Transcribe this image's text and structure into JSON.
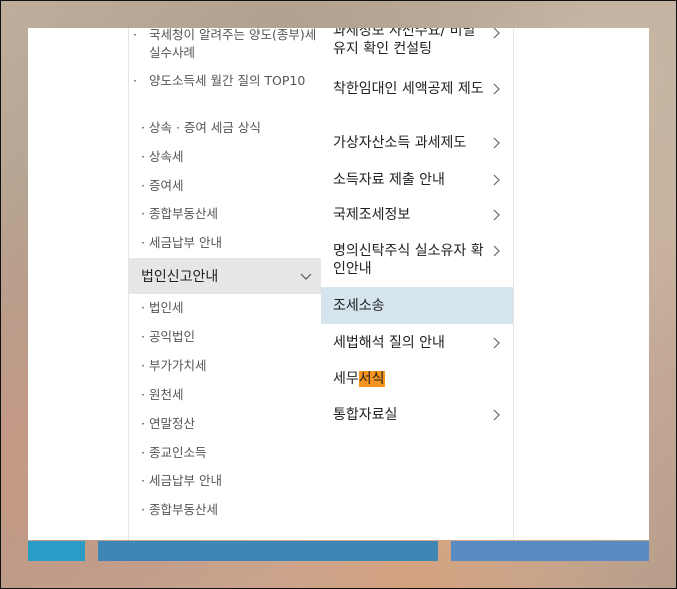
{
  "left_menu": {
    "group1_items": [
      {
        "label": "국세청이 알려주는 양도(종부)세 실수사례"
      },
      {
        "label": "양도소득세 월간 질의 TOP10"
      },
      {
        "label": "상속 · 증여 세금 상식"
      },
      {
        "label": "상속세"
      },
      {
        "label": "증여세"
      },
      {
        "label": "종합부동산세"
      },
      {
        "label": "세금납부 안내"
      }
    ],
    "section_title": "법인신고안내",
    "section_items": [
      {
        "label": "법인세"
      },
      {
        "label": "공익법인"
      },
      {
        "label": "부가가치세"
      },
      {
        "label": "원천세"
      },
      {
        "label": "연말정산"
      },
      {
        "label": "종교인소득"
      },
      {
        "label": "세금납부 안내"
      },
      {
        "label": "종합부동산세"
      }
    ]
  },
  "right_menu": {
    "items": [
      {
        "label": "과세정보 사전수요/ 비밀유지 확인 컨설팅"
      },
      {
        "label": "착한임대인 세액공제 제도"
      },
      {
        "label": "가상자산소득 과세제도"
      },
      {
        "label": "소득자료 제출 안내"
      },
      {
        "label": "국제조세정보"
      },
      {
        "label": "명의신탁주식 실소유자 확인안내"
      },
      {
        "label": "조세소송"
      },
      {
        "label": "세법해석 질의 안내"
      },
      {
        "label_prefix": "세무",
        "label_highlight": "서식"
      },
      {
        "label": "통합자료실"
      }
    ]
  },
  "colors": {
    "active_bg": "#d6e4ee",
    "section_bg": "#e6e6e6",
    "highlight": "#f7941d",
    "bar_left": "#2a9dc6",
    "bar_mid": "#3d86b5",
    "bar_right": "#5a8bc0"
  },
  "icons": {
    "section_toggle": "chevron-down-icon",
    "submenu": "chevron-right-icon"
  }
}
